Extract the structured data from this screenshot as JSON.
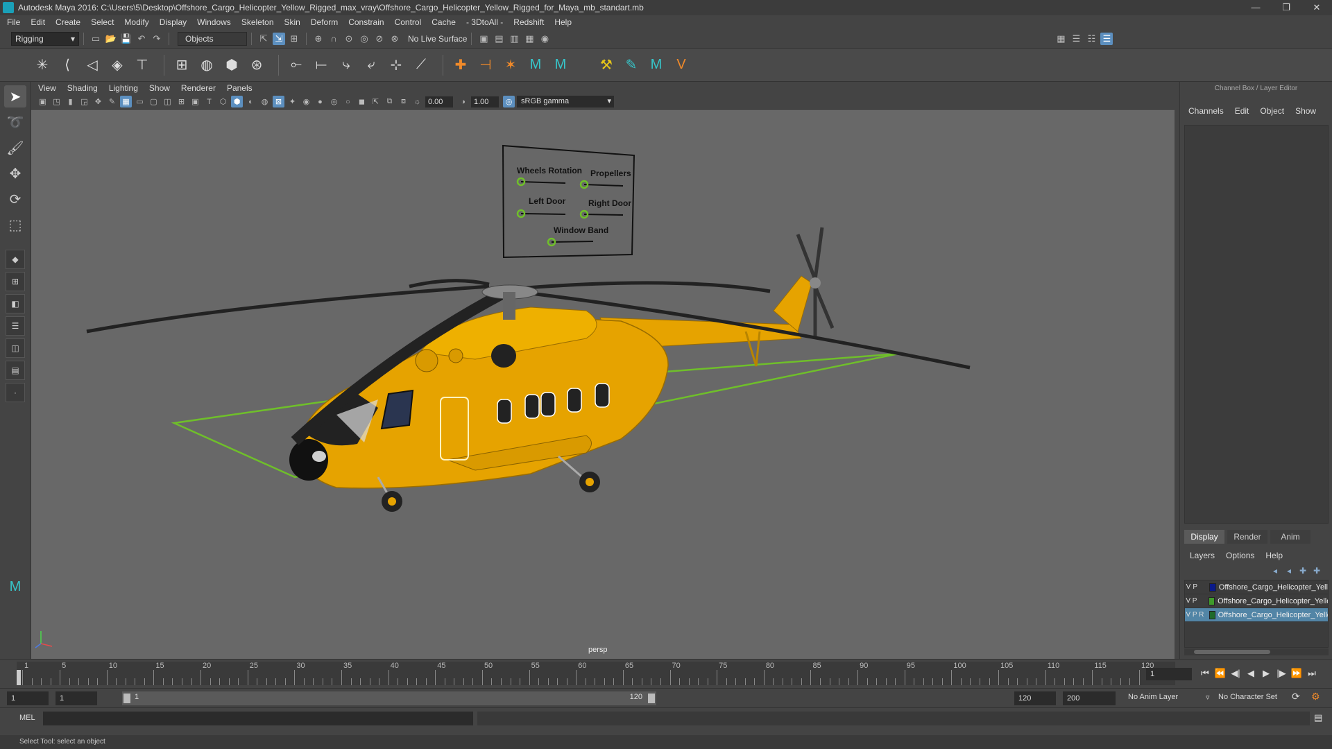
{
  "window": {
    "title": "Autodesk Maya 2016: C:\\Users\\5\\Desktop\\Offshore_Cargo_Helicopter_Yellow_Rigged_max_vray\\Offshore_Cargo_Helicopter_Yellow_Rigged_for_Maya_mb_standart.mb",
    "controls": [
      "—",
      "❐",
      "✕"
    ]
  },
  "menubar": [
    "File",
    "Edit",
    "Create",
    "Select",
    "Modify",
    "Display",
    "Windows",
    "Skeleton",
    "Skin",
    "Deform",
    "Constrain",
    "Control",
    "Cache",
    "- 3DtoAll -",
    "Redshift",
    "Help"
  ],
  "statusline": {
    "mode": "Rigging",
    "selection_field": "Objects",
    "live_surface": "No Live Surface"
  },
  "panel": {
    "menu": [
      "View",
      "Shading",
      "Lighting",
      "Show",
      "Renderer",
      "Panels"
    ],
    "exposure": "0.00",
    "gamma": "1.00",
    "colorspace": "sRGB gamma",
    "camera": "persp"
  },
  "control_board": {
    "labels": [
      "Wheels Rotation",
      "Propellers",
      "Left Door",
      "Right Door",
      "Window Band"
    ]
  },
  "channel_box": {
    "header": "Channel Box / Layer Editor",
    "menu": [
      "Channels",
      "Edit",
      "Object",
      "Show"
    ]
  },
  "layer_editor": {
    "tabs": [
      "Display",
      "Render",
      "Anim"
    ],
    "menu": [
      "Layers",
      "Options",
      "Help"
    ],
    "layers": [
      {
        "v": "V",
        "p": "P",
        "r": "",
        "color": "#0a1a8a",
        "name": "Offshore_Cargo_Helicopter_Yellow_Rigged_Helpers",
        "selected": false
      },
      {
        "v": "V",
        "p": "P",
        "r": "",
        "color": "#3f9a2a",
        "name": "Offshore_Cargo_Helicopter_Yellow_Rigged_Controllers",
        "selected": false
      },
      {
        "v": "V",
        "p": "P",
        "r": "R",
        "color": "#1f6a2a",
        "name": "Offshore_Cargo_Helicopter_Yellow_Rigged_Geometry",
        "selected": true
      }
    ]
  },
  "timeline": {
    "labels": [
      "1",
      "5",
      "10",
      "15",
      "20",
      "25",
      "30",
      "35",
      "40",
      "45",
      "50",
      "55",
      "60",
      "65",
      "70",
      "75",
      "80",
      "85",
      "90",
      "95",
      "100",
      "105",
      "110",
      "115",
      "120"
    ],
    "current_frame": "1",
    "playback_icons": [
      "⏮",
      "⏪",
      "◀|",
      "◀",
      "▶",
      "|▶",
      "⏩",
      "⏭"
    ]
  },
  "range": {
    "start": "1",
    "anim_start": "1",
    "bar_start": "1",
    "bar_end": "120",
    "anim_end": "120",
    "end": "200",
    "anim_layer": "No Anim Layer",
    "character_set": "No Character Set"
  },
  "command": {
    "label": "MEL",
    "help": "Select Tool: select an object"
  },
  "colors": {
    "helicopter": "#e6a300",
    "grid_wire": "#6fbf2a",
    "viewport_bg": "#686868",
    "selection_blue": "#5285a6"
  }
}
